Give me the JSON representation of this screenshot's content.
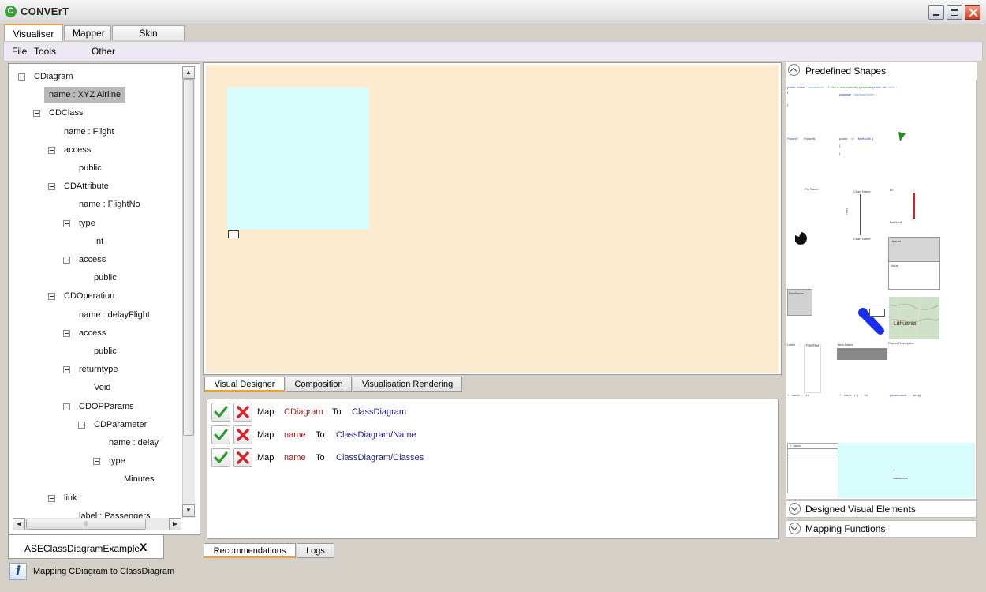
{
  "window": {
    "title": "CONVErT",
    "icon_letter": "C"
  },
  "main_tabs": [
    {
      "label": "Visualiser",
      "active": true
    },
    {
      "label": "Mapper",
      "active": false
    },
    {
      "label": "Skin Designer",
      "active": false
    }
  ],
  "menu": [
    "File",
    "Tools",
    "Other"
  ],
  "tree": [
    {
      "label": "CDiagram",
      "depth": 0,
      "toggle": true
    },
    {
      "label": "name : XYZ Airline",
      "depth": 1,
      "toggle": false,
      "selected": true
    },
    {
      "label": "CDClass",
      "depth": 1,
      "toggle": true
    },
    {
      "label": "name : Flight",
      "depth": 2,
      "toggle": false
    },
    {
      "label": "access",
      "depth": 2,
      "toggle": true
    },
    {
      "label": "public",
      "depth": 3,
      "toggle": false
    },
    {
      "label": "CDAttribute",
      "depth": 2,
      "toggle": true
    },
    {
      "label": "name : FlightNo",
      "depth": 3,
      "toggle": false
    },
    {
      "label": "type",
      "depth": 3,
      "toggle": true
    },
    {
      "label": "Int",
      "depth": 4,
      "toggle": false
    },
    {
      "label": "access",
      "depth": 3,
      "toggle": true
    },
    {
      "label": "public",
      "depth": 4,
      "toggle": false
    },
    {
      "label": "CDOperation",
      "depth": 2,
      "toggle": true
    },
    {
      "label": "name : delayFlight",
      "depth": 3,
      "toggle": false
    },
    {
      "label": "access",
      "depth": 3,
      "toggle": true
    },
    {
      "label": "public",
      "depth": 4,
      "toggle": false
    },
    {
      "label": "returntype",
      "depth": 3,
      "toggle": true
    },
    {
      "label": "Void",
      "depth": 4,
      "toggle": false
    },
    {
      "label": "CDOPParams",
      "depth": 3,
      "toggle": true
    },
    {
      "label": "CDParameter",
      "depth": 4,
      "toggle": true
    },
    {
      "label": "name : delay",
      "depth": 5,
      "toggle": false
    },
    {
      "label": "type",
      "depth": 5,
      "toggle": true
    },
    {
      "label": "Minutes",
      "depth": 6,
      "toggle": false
    },
    {
      "label": "link",
      "depth": 2,
      "toggle": true
    },
    {
      "label": "label : Passengers",
      "depth": 3,
      "toggle": false
    }
  ],
  "document_tab": {
    "label": "ASEClassDiagramExample",
    "close": "X"
  },
  "status": {
    "text": "Mapping CDiagram to ClassDiagram",
    "icon": "info-icon"
  },
  "designer_tabs": [
    {
      "label": "Visual Designer",
      "active": true
    },
    {
      "label": "Composition",
      "active": false
    },
    {
      "label": "Visualisation Rendering",
      "active": false
    }
  ],
  "recommendations": [
    {
      "verb": "Map",
      "source": "CDiagram",
      "to": "To",
      "target": "ClassDiagram"
    },
    {
      "verb": "Map",
      "source": "name",
      "to": "To",
      "target": "ClassDiagram/Name"
    },
    {
      "verb": "Map",
      "source": "name",
      "to": "To",
      "target": "ClassDiagram/Classes"
    }
  ],
  "bottom_tabs": [
    {
      "label": "Recommendations",
      "active": true
    },
    {
      "label": "Logs",
      "active": false
    }
  ],
  "right_panel": {
    "predefined_shapes": "Predefined Shapes",
    "designed_visual_elements": "Designed Visual Elements",
    "mapping_functions": "Mapping Functions"
  },
  "colors": {
    "canvas_bg": "#fdebcf",
    "canvas_shape": "#d9fcfd",
    "source_text": "#b01818",
    "target_text": "#1b1b8a",
    "tab_accent": "#f0a030"
  }
}
